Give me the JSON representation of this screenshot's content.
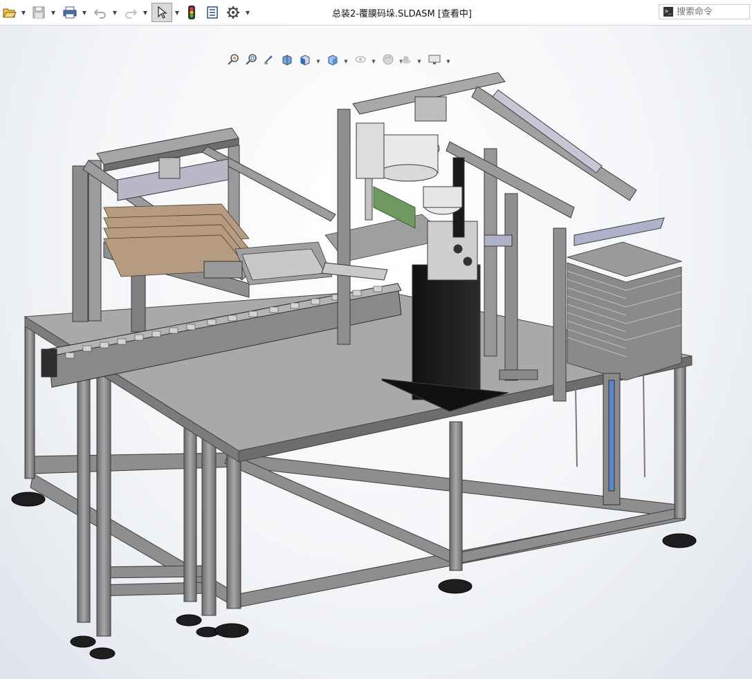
{
  "toolbar": {
    "open_icon": "open-file-icon",
    "save_icon": "save-icon",
    "print_icon": "print-icon",
    "undo_icon": "undo-icon",
    "redo_icon": "redo-icon",
    "select_icon": "select-cursor-icon",
    "rebuild_icon": "traffic-light-icon",
    "file_props_icon": "file-properties-icon",
    "options_icon": "gear-icon"
  },
  "window": {
    "title": "总装2-覆膜码垛.SLDASM [查看中]"
  },
  "search": {
    "placeholder": "搜索命令"
  },
  "headsup_toolbar": {
    "items": [
      "zoom-to-fit-icon",
      "zoom-to-area-icon",
      "previous-view-icon",
      "section-view-icon",
      "view-orientation-icon",
      "display-style-icon",
      "hide-show-items-icon",
      "edit-appearance-icon",
      "apply-scene-icon",
      "view-settings-icon"
    ]
  },
  "colors": {
    "frame": "#8c8c8c",
    "frame_dark": "#5a5a5a",
    "frame_light": "#b4b4b4",
    "plate": "#9a9a9a",
    "accent": "#2f6ebd",
    "robot_white": "#e9e9e9",
    "pedestal": "#1b1b1b",
    "green_strip": "#6e9a62"
  }
}
